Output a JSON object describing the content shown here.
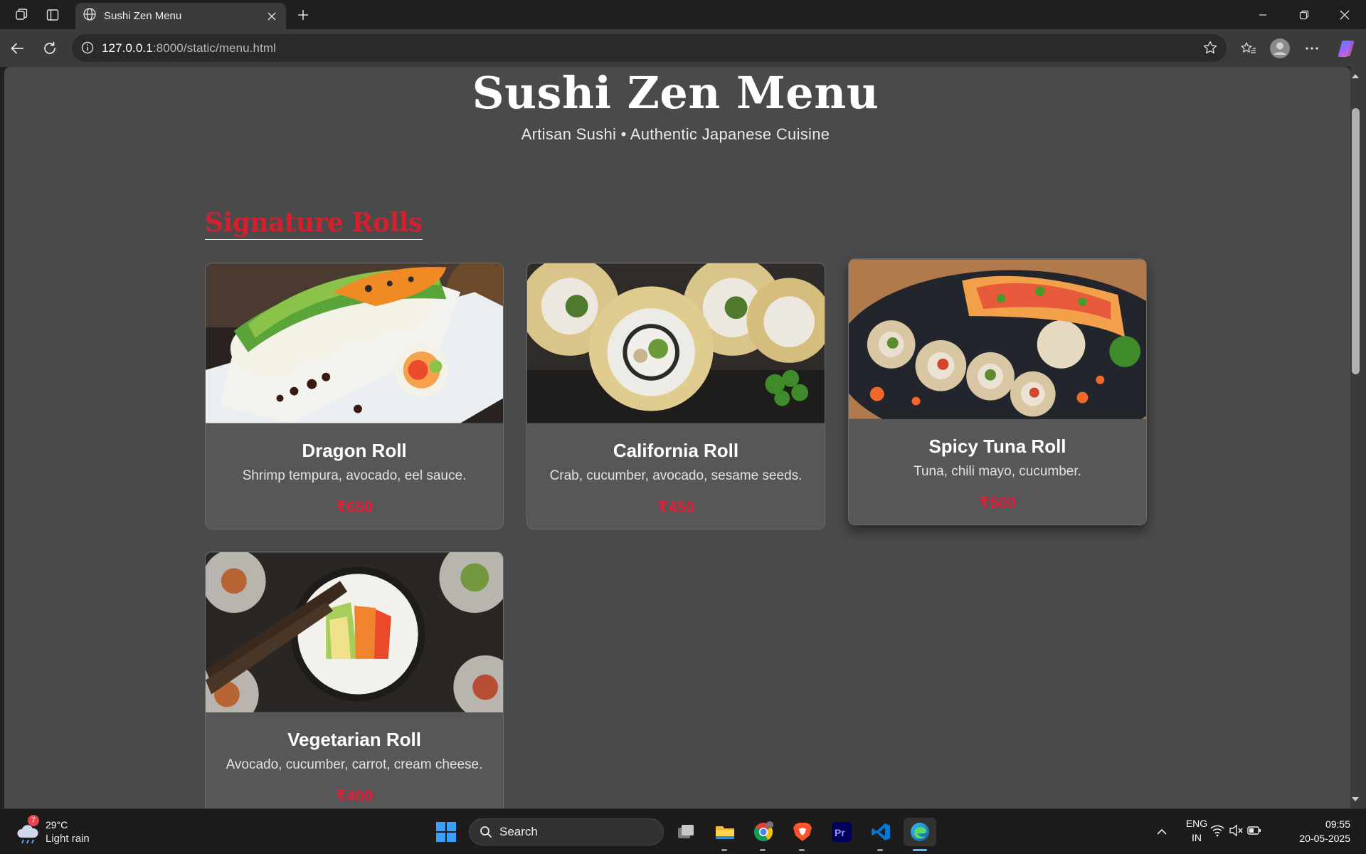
{
  "browser": {
    "tab_title": "Sushi Zen Menu",
    "url_host": "127.0.0.1",
    "url_rest": ":8000/static/menu.html"
  },
  "page": {
    "title": "Sushi Zen Menu",
    "subtitle": "Artisan Sushi • Authentic Japanese Cuisine",
    "section_title": "Signature Rolls",
    "accent_color": "#d4202e",
    "items": [
      {
        "name": "Dragon Roll",
        "description": "Shrimp tempura, avocado, eel sauce.",
        "price": "₹650",
        "image": "dragon-roll-photo"
      },
      {
        "name": "California Roll",
        "description": "Crab, cucumber, avocado, sesame seeds.",
        "price": "₹450",
        "image": "california-roll-photo"
      },
      {
        "name": "Spicy Tuna Roll",
        "description": "Tuna, chili mayo, cucumber.",
        "price": "₹500",
        "image": "spicy-tuna-roll-photo"
      },
      {
        "name": "Vegetarian Roll",
        "description": "Avocado, cucumber, carrot, cream cheese.",
        "price": "₹400",
        "image": "vegetarian-roll-photo"
      }
    ]
  },
  "taskbar": {
    "weather_temp": "29°C",
    "weather_condition": "Light rain",
    "weather_badge": "7",
    "search_label": "Search",
    "language_line1": "ENG",
    "language_line2": "IN",
    "time": "09:55",
    "date": "20-05-2025"
  }
}
